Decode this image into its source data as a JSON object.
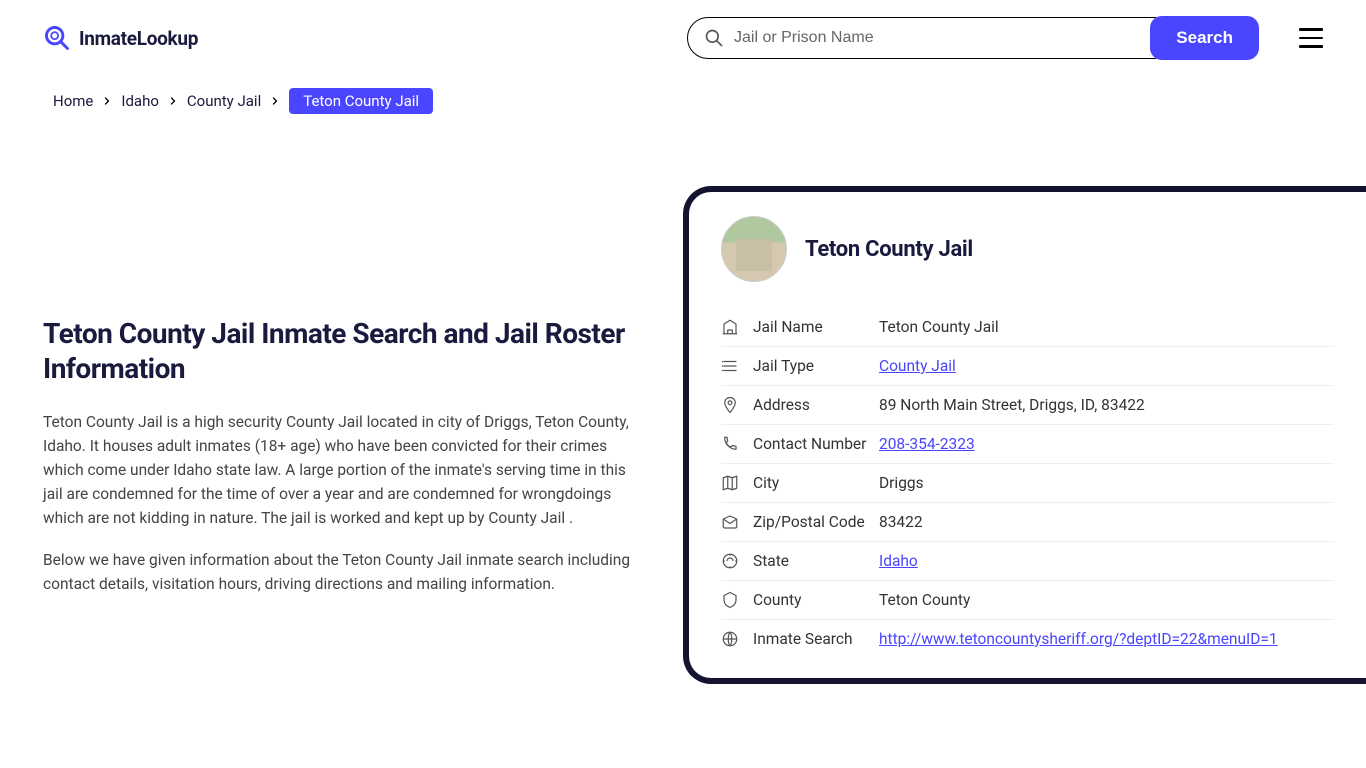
{
  "header": {
    "logo_text": "InmateLookup",
    "search_placeholder": "Jail or Prison Name",
    "search_button": "Search"
  },
  "breadcrumb": {
    "items": [
      "Home",
      "Idaho",
      "County Jail"
    ],
    "current": "Teton County Jail"
  },
  "page": {
    "title": "Teton County Jail Inmate Search and Jail Roster Information",
    "para1": "Teton County Jail is a high security County Jail located in city of Driggs, Teton County, Idaho. It houses adult inmates (18+ age) who have been convicted for their crimes which come under Idaho state law. A large portion of the inmate's serving time in this jail are condemned for the time of over a year and are condemned for wrongdoings which are not kidding in nature. The jail is worked and kept up by County Jail .",
    "para2": "Below we have given information about the Teton County Jail inmate search including contact details, visitation hours, driving directions and mailing information."
  },
  "card": {
    "title": "Teton County Jail",
    "rows": [
      {
        "label": "Jail Name",
        "value": "Teton County Jail",
        "link": false
      },
      {
        "label": "Jail Type",
        "value": "County Jail",
        "link": true
      },
      {
        "label": "Address",
        "value": "89 North Main Street, Driggs, ID, 83422",
        "link": false
      },
      {
        "label": "Contact Number",
        "value": "208-354-2323",
        "link": true
      },
      {
        "label": "City",
        "value": "Driggs",
        "link": false
      },
      {
        "label": "Zip/Postal Code",
        "value": "83422",
        "link": false
      },
      {
        "label": "State",
        "value": "Idaho",
        "link": true
      },
      {
        "label": "County",
        "value": "Teton County",
        "link": false
      },
      {
        "label": "Inmate Search",
        "value": "http://www.tetoncountysheriff.org/?deptID=22&menuID=1",
        "link": true
      }
    ]
  }
}
